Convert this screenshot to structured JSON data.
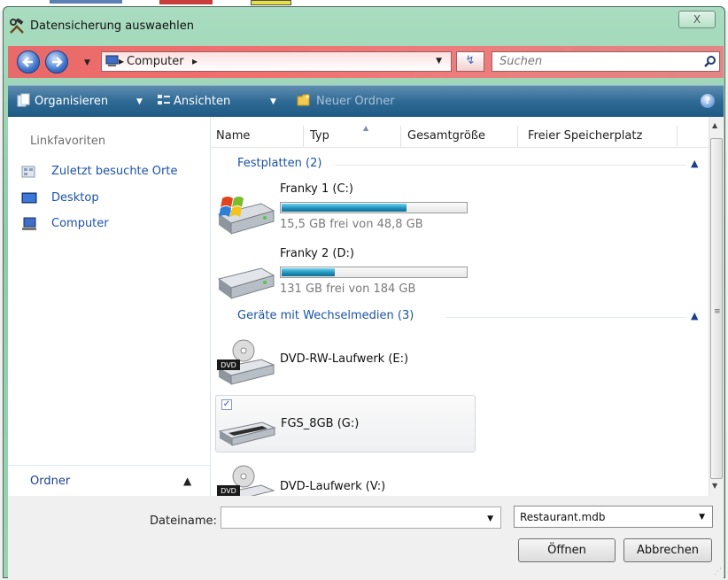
{
  "window": {
    "title": "Datensicherung auswaehlen",
    "close_label": "X"
  },
  "address": {
    "segments": [
      "Computer"
    ],
    "separator": "▸",
    "search_placeholder": "Suchen"
  },
  "toolbar": {
    "organize": "Organisieren",
    "views": "Ansichten",
    "new_folder": "Neuer Ordner",
    "help": "?"
  },
  "nav": {
    "heading": "Linkfavoriten",
    "items": [
      {
        "label": "Zuletzt besuchte Orte",
        "icon": "recent-places-icon"
      },
      {
        "label": "Desktop",
        "icon": "desktop-icon"
      },
      {
        "label": "Computer",
        "icon": "computer-icon"
      }
    ],
    "folders_label": "Ordner"
  },
  "columns": [
    "Name",
    "Typ",
    "Gesamtgröße",
    "Freier Speicherplatz"
  ],
  "groups": {
    "hard_disks": "Festplatten (2)",
    "removable": "Geräte mit Wechselmedien (3)"
  },
  "drives": [
    {
      "name": "Franky 1 (C:)",
      "free_text": "15,5 GB frei von 48,8 GB",
      "used_fraction": 0.68,
      "icon": "windows-drive-icon"
    },
    {
      "name": "Franky 2 (D:)",
      "free_text": "131 GB frei von 184 GB",
      "used_fraction": 0.29,
      "icon": "hard-drive-icon"
    }
  ],
  "removable": [
    {
      "name": "DVD-RW-Laufwerk (E:)",
      "icon": "dvd-drive-icon"
    },
    {
      "name": "FGS_8GB (G:)",
      "icon": "usb-drive-icon",
      "checked": true
    },
    {
      "name": "DVD-Laufwerk (V:)",
      "icon": "dvd-drive-icon"
    }
  ],
  "footer": {
    "filename_label": "Dateiname:",
    "filename_value": "",
    "filetype_value": "Restaurant.mdb",
    "open_button": "Öffnen",
    "cancel_button": "Abbrechen"
  },
  "colors": {
    "title_bg": "#a9dcc0",
    "address_bg": "#f26d6d",
    "toolbar_bg": "#2f6a94",
    "link_blue": "#1a52a8",
    "progress_fill": "#1c8fb8"
  }
}
